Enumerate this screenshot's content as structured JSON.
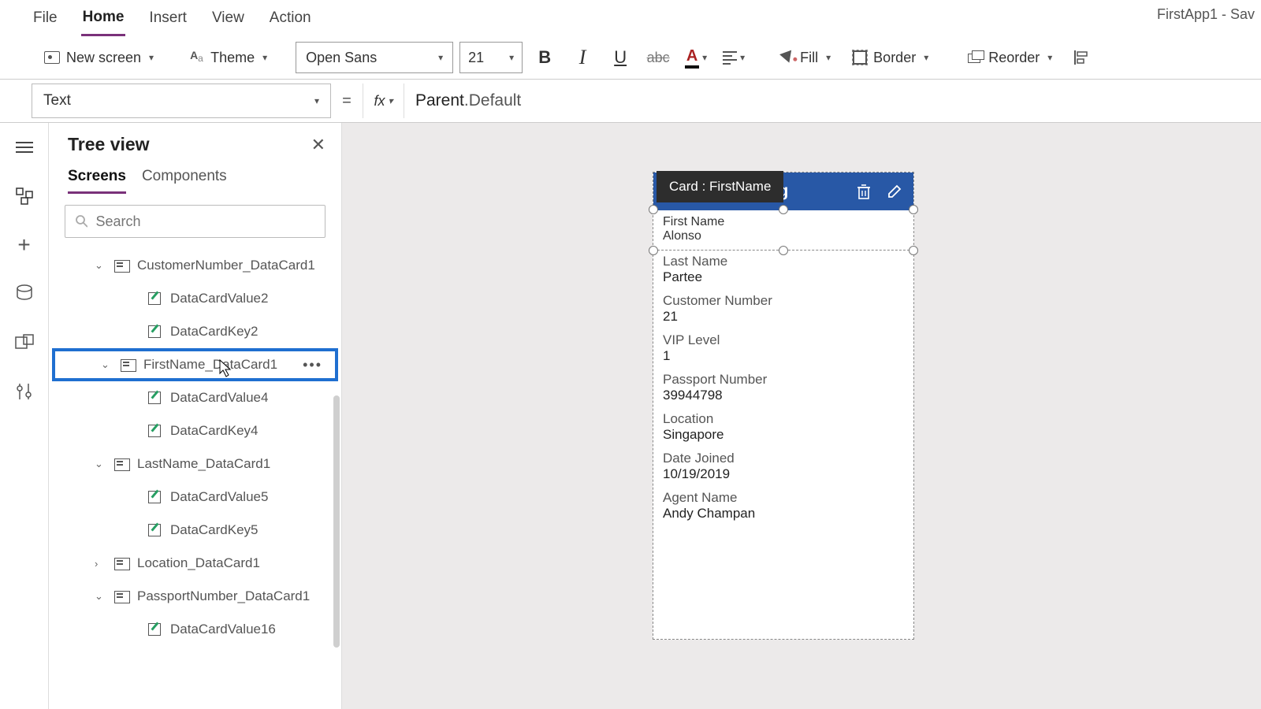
{
  "app_title": "FirstApp1 - Sav",
  "menu": {
    "file": "File",
    "home": "Home",
    "insert": "Insert",
    "view": "View",
    "action": "Action"
  },
  "ribbon": {
    "new_screen": "New screen",
    "theme": "Theme",
    "font_family": "Open Sans",
    "font_size": "21",
    "fill": "Fill",
    "border": "Border",
    "reorder": "Reorder"
  },
  "formula": {
    "property": "Text",
    "expression_parent": "Parent",
    "expression_dot": ".",
    "expression_member": "Default"
  },
  "tree": {
    "title": "Tree view",
    "tab_screens": "Screens",
    "tab_components": "Components",
    "search_placeholder": "Search",
    "items": [
      {
        "label": "CustomerNumber_DataCard1",
        "kind": "card",
        "level": 1,
        "expanded": true
      },
      {
        "label": "DataCardValue2",
        "kind": "value",
        "level": 2
      },
      {
        "label": "DataCardKey2",
        "kind": "value",
        "level": 2
      },
      {
        "label": "FirstName_DataCard1",
        "kind": "card",
        "level": 1,
        "expanded": true,
        "selected": true
      },
      {
        "label": "DataCardValue4",
        "kind": "value",
        "level": 2
      },
      {
        "label": "DataCardKey4",
        "kind": "value",
        "level": 2
      },
      {
        "label": "LastName_DataCard1",
        "kind": "card",
        "level": 1,
        "expanded": true
      },
      {
        "label": "DataCardValue5",
        "kind": "value",
        "level": 2
      },
      {
        "label": "DataCardKey5",
        "kind": "value",
        "level": 2
      },
      {
        "label": "Location_DataCard1",
        "kind": "card",
        "level": 1,
        "expanded": false
      },
      {
        "label": "PassportNumber_DataCard1",
        "kind": "card",
        "level": 1,
        "expanded": true
      },
      {
        "label": "DataCardValue16",
        "kind": "value",
        "level": 2
      }
    ]
  },
  "canvas": {
    "selection_label": "Card : FirstName",
    "header_suffix": "ling",
    "fields": [
      {
        "label": "First Name",
        "value": "Alonso"
      },
      {
        "label": "Last Name",
        "value": "Partee"
      },
      {
        "label": "Customer Number",
        "value": "21"
      },
      {
        "label": "VIP Level",
        "value": "1"
      },
      {
        "label": "Passport Number",
        "value": "39944798"
      },
      {
        "label": "Location",
        "value": "Singapore"
      },
      {
        "label": "Date Joined",
        "value": "10/19/2019"
      },
      {
        "label": "Agent Name",
        "value": "Andy Champan"
      }
    ]
  }
}
